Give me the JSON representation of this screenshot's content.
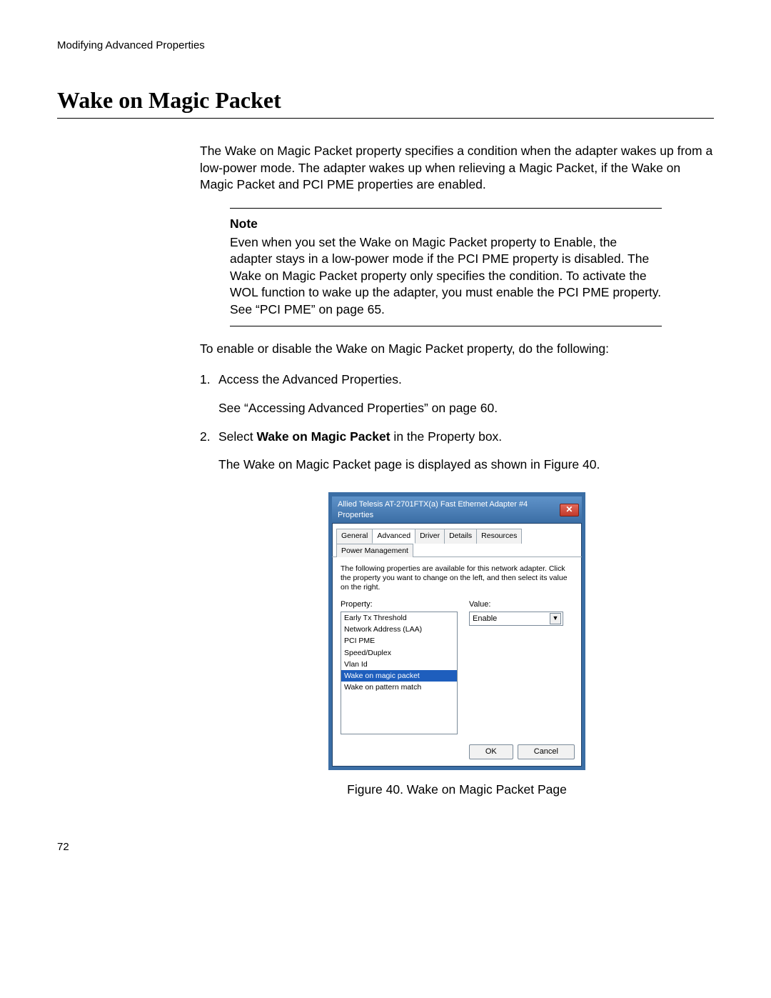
{
  "running_head": "Modifying Advanced Properties",
  "heading": "Wake on Magic Packet",
  "intro": "The Wake on Magic Packet property specifies a condition when the adapter wakes up from a low-power mode. The adapter wakes up when relieving a Magic Packet, if the Wake on Magic Packet and PCI PME properties are enabled.",
  "note": {
    "title": "Note",
    "body": "Even when you set the Wake on Magic Packet property to Enable, the adapter stays in a low-power mode if the PCI PME property is disabled. The Wake on Magic Packet property only specifies the condition. To activate the WOL function to wake up the adapter, you must enable the PCI PME property. See “PCI PME” on page 65."
  },
  "lead": "To enable or disable the Wake on Magic Packet property, do the following:",
  "steps": [
    {
      "num": "1.",
      "text": "Access the Advanced Properties.",
      "sub": "See “Accessing Advanced Properties” on page 60."
    },
    {
      "num": "2.",
      "prefix": "Select ",
      "bold": "Wake on Magic Packet",
      "suffix": " in the Property box.",
      "sub": "The Wake on Magic Packet page is displayed as shown in Figure 40."
    }
  ],
  "dialog": {
    "title": "Allied Telesis AT-2701FTX(a) Fast Ethernet Adapter #4 Properties",
    "tabs": [
      "General",
      "Advanced",
      "Driver",
      "Details",
      "Resources",
      "Power Management"
    ],
    "active_tab": "Advanced",
    "description": "The following properties are available for this network adapter. Click the property you want to change on the left, and then select its value on the right.",
    "property_label": "Property:",
    "value_label": "Value:",
    "properties": [
      "Early Tx Threshold",
      "Network Address (LAA)",
      "PCI PME",
      "Speed/Duplex",
      "Vlan Id",
      "Wake on magic packet",
      "Wake on pattern match"
    ],
    "selected_property": "Wake on magic packet",
    "value": "Enable",
    "ok": "OK",
    "cancel": "Cancel"
  },
  "figure_caption": "Figure 40. Wake on Magic Packet Page",
  "page_number": "72"
}
